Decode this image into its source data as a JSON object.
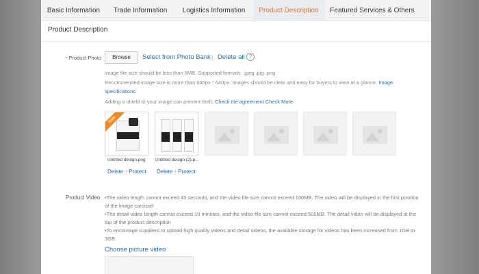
{
  "tabs": [
    {
      "label": "Basic Information"
    },
    {
      "label": "Trade Information"
    },
    {
      "label": "Logistics Information"
    },
    {
      "label": "Product Description"
    },
    {
      "label": "Featured Services & Others"
    }
  ],
  "section_title": "Product Description",
  "product_photo": {
    "label": "Product Photo",
    "browse_label": "Browse",
    "photo_bank_label": "Select from Photo Bank",
    "delete_all_label": "Delete all",
    "help": "?",
    "note_size": "Image file size should be less than 5MB. Supported formats: .jpeg .jpg .png",
    "note_recommend": "Recommended image size is more than 640px * 640px. Images should be clear and easy for buyers to view at a glance.",
    "image_spec_link": "Image specifications",
    "note_shield": "Adding a shield to your image can prevent theft;",
    "check_agreement": "Check the agreement",
    "check_more": "Check More",
    "sale_badge": "Sale",
    "images": [
      {
        "caption": "Untitled design.png",
        "delete": "Delete",
        "protect": "Protect"
      },
      {
        "caption": "Untitled design (2).p...",
        "delete": "Delete",
        "protect": "Protect"
      }
    ],
    "separator": "|"
  },
  "product_video": {
    "label": "Product Video",
    "notes": [
      "•The video length cannot exceed 45 seconds, and the video file size cannot exceed 100MB. The video will be displayed in the first position of the image carousel",
      "•The detail video length cannot exceed 10 minutes, and the video file size cannot exceed 500MB. The detail video will be displayed at the top of the product description",
      "•To encourage suppliers to upload high quality videos and detail videos, the available storage for videos has been increased from 1GB to 3GB."
    ],
    "choose_label": "Choose picture video"
  }
}
